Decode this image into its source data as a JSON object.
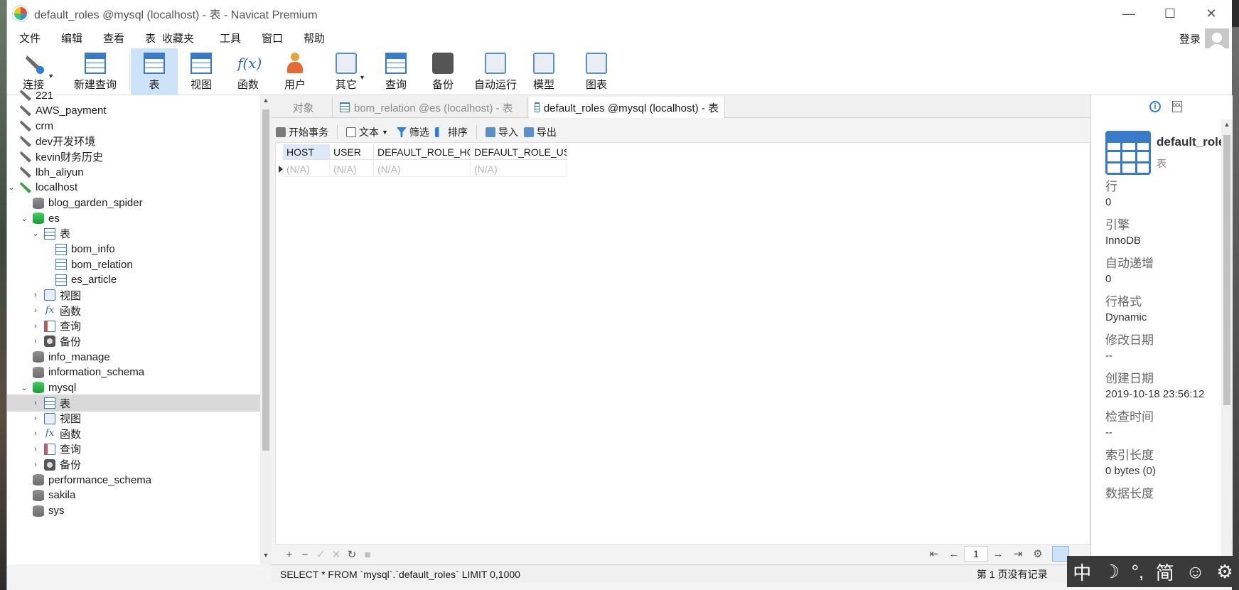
{
  "window": {
    "title": "default_roles @mysql (localhost) - 表 - Navicat Premium",
    "controls": {
      "minimize": "—",
      "maximize": "☐",
      "close": "✕"
    }
  },
  "menu": {
    "items": [
      "文件",
      "编辑",
      "查看",
      "表",
      "收藏夹",
      "工具",
      "窗口",
      "帮助"
    ],
    "login": "登录"
  },
  "toolbar": {
    "buttons": [
      {
        "label": "连接",
        "icon": "connection-icon"
      },
      {
        "label": "新建查询",
        "icon": "new-query-icon"
      },
      {
        "label": "表",
        "icon": "table-icon"
      },
      {
        "label": "视图",
        "icon": "view-icon"
      },
      {
        "label": "函数",
        "icon": "function-icon"
      },
      {
        "label": "用户",
        "icon": "user-icon"
      },
      {
        "label": "其它",
        "icon": "other-tools-icon"
      },
      {
        "label": "查询",
        "icon": "query-icon"
      },
      {
        "label": "备份",
        "icon": "backup-icon"
      },
      {
        "label": "自动运行",
        "icon": "auto-run-icon"
      },
      {
        "label": "模型",
        "icon": "model-icon"
      },
      {
        "label": "图表",
        "icon": "chart-icon"
      }
    ],
    "active": "表"
  },
  "tree": {
    "items": [
      {
        "label": "221",
        "icon": "connection-icon",
        "level": 0,
        "expand": ""
      },
      {
        "label": "AWS_payment",
        "icon": "connection-icon",
        "level": 0,
        "expand": ""
      },
      {
        "label": "crm",
        "icon": "connection-icon",
        "level": 0,
        "expand": ""
      },
      {
        "label": "dev开发环境",
        "icon": "connection-icon",
        "level": 0,
        "expand": ""
      },
      {
        "label": "kevin财务历史",
        "icon": "connection-icon",
        "level": 0,
        "expand": ""
      },
      {
        "label": "lbh_aliyun",
        "icon": "connection-icon",
        "level": 0,
        "expand": ""
      },
      {
        "label": "localhost",
        "icon": "connection-open-icon",
        "level": 0,
        "expand": "open"
      },
      {
        "label": "blog_garden_spider",
        "icon": "database-icon",
        "level": 1,
        "expand": ""
      },
      {
        "label": "es",
        "icon": "database-open-icon",
        "level": 1,
        "expand": "open"
      },
      {
        "label": "表",
        "icon": "tables-folder-icon",
        "level": 2,
        "expand": "open"
      },
      {
        "label": "bom_info",
        "icon": "table-icon",
        "level": 3,
        "expand": ""
      },
      {
        "label": "bom_relation",
        "icon": "table-icon",
        "level": 3,
        "expand": ""
      },
      {
        "label": "es_article",
        "icon": "table-icon",
        "level": 3,
        "expand": ""
      },
      {
        "label": "视图",
        "icon": "view-icon",
        "level": 2,
        "expand": "closed"
      },
      {
        "label": "函数",
        "icon": "function-icon",
        "level": 2,
        "expand": "closed"
      },
      {
        "label": "查询",
        "icon": "query-icon",
        "level": 2,
        "expand": "closed"
      },
      {
        "label": "备份",
        "icon": "backup-icon",
        "level": 2,
        "expand": "closed"
      },
      {
        "label": "info_manage",
        "icon": "database-icon",
        "level": 1,
        "expand": ""
      },
      {
        "label": "information_schema",
        "icon": "database-icon",
        "level": 1,
        "expand": ""
      },
      {
        "label": "mysql",
        "icon": "database-open-icon",
        "level": 1,
        "expand": "open"
      },
      {
        "label": "表",
        "icon": "tables-folder-icon",
        "level": 2,
        "expand": "closed",
        "selected": true
      },
      {
        "label": "视图",
        "icon": "view-icon",
        "level": 2,
        "expand": "closed"
      },
      {
        "label": "函数",
        "icon": "function-icon",
        "level": 2,
        "expand": "closed"
      },
      {
        "label": "查询",
        "icon": "query-icon",
        "level": 2,
        "expand": "closed"
      },
      {
        "label": "备份",
        "icon": "backup-icon",
        "level": 2,
        "expand": "closed"
      },
      {
        "label": "performance_schema",
        "icon": "database-icon",
        "level": 1,
        "expand": ""
      },
      {
        "label": "sakila",
        "icon": "database-icon",
        "level": 1,
        "expand": ""
      },
      {
        "label": "sys",
        "icon": "database-icon",
        "level": 1,
        "expand": ""
      }
    ]
  },
  "tabs": [
    {
      "label": "对象",
      "active": false
    },
    {
      "label": "bom_relation @es (localhost) - 表",
      "active": false
    },
    {
      "label": "default_roles @mysql (localhost) - 表",
      "active": true
    }
  ],
  "subtoolbar": {
    "begin_transaction": "开始事务",
    "text": "文本",
    "filter": "筛选",
    "sort": "排序",
    "import": "导入",
    "export": "导出"
  },
  "grid": {
    "columns": [
      "HOST",
      "USER",
      "DEFAULT_ROLE_HOST",
      "DEFAULT_ROLE_USER"
    ],
    "rows": [
      [
        "(N/A)",
        "(N/A)",
        "(N/A)",
        "(N/A)"
      ]
    ]
  },
  "bottombar": {
    "add": "+",
    "remove": "−",
    "apply": "✓",
    "cancel": "✕",
    "refresh": "↻",
    "stop": "■",
    "first": "⇤",
    "prev": "←",
    "page": "1",
    "next": "→",
    "last": "⇥",
    "settings": "⚙"
  },
  "status": {
    "sql": "SELECT * FROM `mysql`.`default_roles` LIMIT 0,1000",
    "records": "第 1 页没有记录"
  },
  "info_panel": {
    "name": "default_roles",
    "type": "表",
    "props": [
      {
        "key": "行",
        "value": "0"
      },
      {
        "key": "引擎",
        "value": "InnoDB"
      },
      {
        "key": "自动递增",
        "value": "0"
      },
      {
        "key": "行格式",
        "value": "Dynamic"
      },
      {
        "key": "修改日期",
        "value": "--"
      },
      {
        "key": "创建日期",
        "value": "2019-10-18 23:56:12"
      },
      {
        "key": "检查时间",
        "value": "--"
      },
      {
        "key": "索引长度",
        "value": "0 bytes (0)"
      },
      {
        "key": "数据长度",
        "value": ""
      }
    ]
  },
  "ime": {
    "items": [
      "中",
      "☽",
      "°,",
      "简",
      "☺",
      "⚙"
    ]
  }
}
